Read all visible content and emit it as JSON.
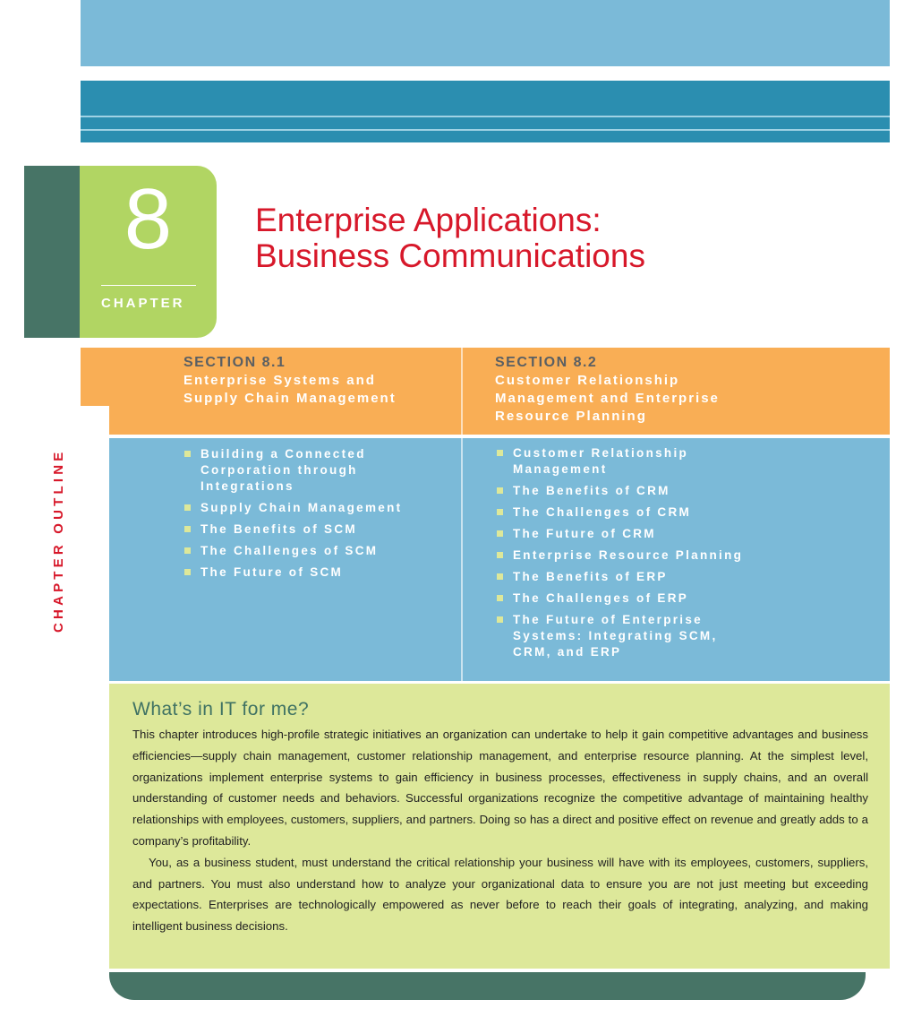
{
  "chapter": {
    "number": "8",
    "label": "CHAPTER",
    "title_line1": "Enterprise Applications:",
    "title_line2": "Business Communications"
  },
  "outline_label": "CHAPTER OUTLINE",
  "sections": [
    {
      "number": "SECTION 8.1",
      "name_lines": [
        "Enterprise Systems and",
        "Supply Chain Management"
      ],
      "items": [
        [
          "Building a Connected",
          "Corporation through",
          "Integrations"
        ],
        [
          "Supply Chain Management"
        ],
        [
          "The Benefits of SCM"
        ],
        [
          "The Challenges of SCM"
        ],
        [
          "The Future of SCM"
        ]
      ]
    },
    {
      "number": "SECTION 8.2",
      "name_lines": [
        "Customer Relationship",
        "Management and Enterprise",
        "Resource Planning"
      ],
      "items": [
        [
          "Customer Relationship",
          "Management"
        ],
        [
          "The Benefits of CRM"
        ],
        [
          "The Challenges of CRM"
        ],
        [
          "The Future of CRM"
        ],
        [
          "Enterprise Resource Planning"
        ],
        [
          "The Benefits of ERP"
        ],
        [
          "The Challenges of ERP"
        ],
        [
          "The Future of Enterprise",
          "Systems: Integrating SCM,",
          "CRM, and ERP"
        ]
      ]
    }
  ],
  "wiifm": {
    "title": "What’s in IT for me?",
    "paragraphs": [
      "This chapter introduces high-profile strategic initiatives an organization can undertake to help it gain competitive advantages and business efficiencies—supply chain management, customer relationship management, and enterprise resource planning. At the simplest level, organizations implement enterprise systems to gain efficiency in business processes, effectiveness in supply chains, and an overall understanding of customer needs and behaviors. Successful organizations recognize the competitive advantage of maintaining healthy relationships with employees, customers, suppliers, and partners. Doing so has a direct and positive effect on revenue and greatly adds to a company’s profitability.",
      "You, as a business student, must understand the critical relationship your business will have with its employees, customers, suppliers, and partners. You must also understand how to analyze your organizational data to ensure you are not just meeting but exceeding expectations. Enterprises are technologically empowered as never before to reach their goals of integrating, analyzing, and making intelligent business decisions."
    ]
  },
  "colors": {
    "light_blue": "#7bbad8",
    "teal": "#2b8eb0",
    "dark_green": "#477466",
    "lime": "#b1d563",
    "orange": "#f9ae55",
    "pale_green": "#dde89a",
    "red": "#d7182a"
  }
}
